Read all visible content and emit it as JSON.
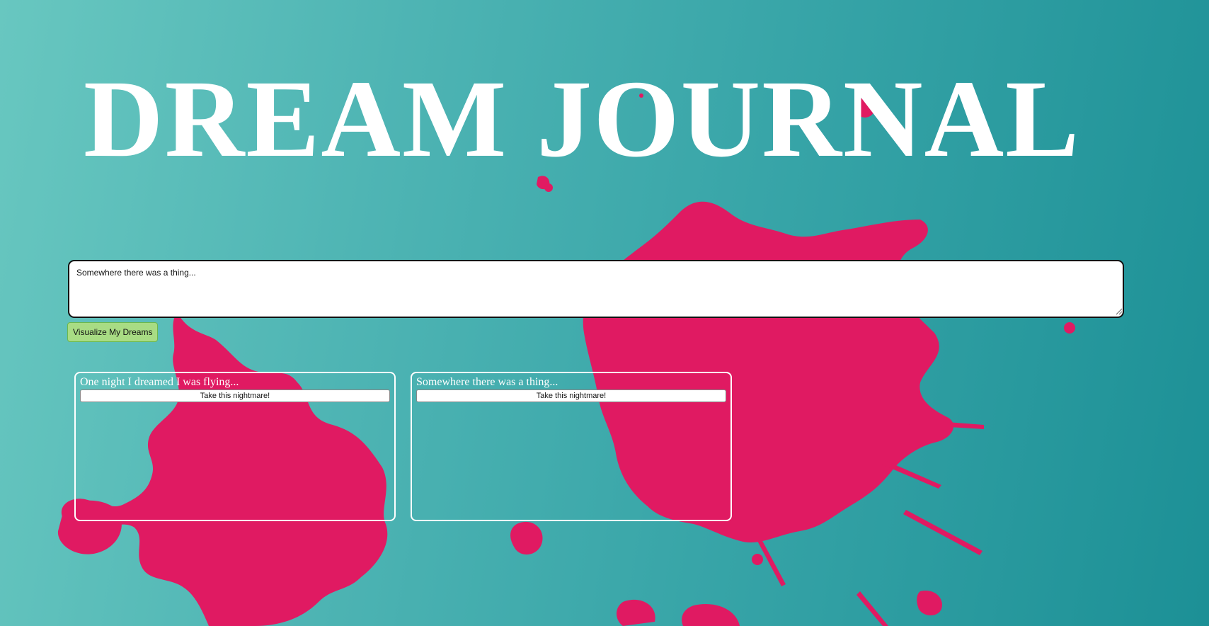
{
  "page": {
    "title": "DREAM JOURNAL"
  },
  "colors": {
    "background_start": "#68c7c0",
    "background_end": "#1c9096",
    "splatter": "#e01a62",
    "button_green": "#a8dc84"
  },
  "form": {
    "input_value": "Somewhere there was a thing...",
    "submit_label": "Visualize My Dreams"
  },
  "dreams": [
    {
      "text": "One night I dreamed I was flying...",
      "button_label": "Take this nightmare!"
    },
    {
      "text": "Somewhere there was a thing...",
      "button_label": "Take this nightmare!"
    }
  ]
}
